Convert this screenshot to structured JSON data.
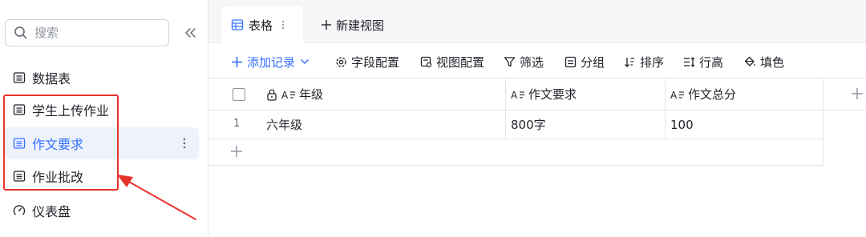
{
  "sidebar": {
    "search_placeholder": "搜索",
    "items": [
      {
        "label": "数据表"
      },
      {
        "label": "学生上传作业"
      },
      {
        "label": "作文要求"
      },
      {
        "label": "作业批改"
      },
      {
        "label": "仪表盘"
      }
    ]
  },
  "tabs": {
    "active_label": "表格",
    "new_view_label": "新建视图"
  },
  "toolbar": {
    "add_record": "添加记录",
    "field_config": "字段配置",
    "view_config": "视图配置",
    "filter": "筛选",
    "group": "分组",
    "sort": "排序",
    "row_height": "行高",
    "fill": "填色"
  },
  "grid": {
    "columns": [
      "年级",
      "作文要求",
      "作文总分"
    ],
    "rows": [
      {
        "num": "1",
        "grade": "六年级",
        "requirement": "800字",
        "score": "100"
      }
    ]
  },
  "colors": {
    "accent": "#3370ff",
    "annotation": "#e8322c"
  }
}
